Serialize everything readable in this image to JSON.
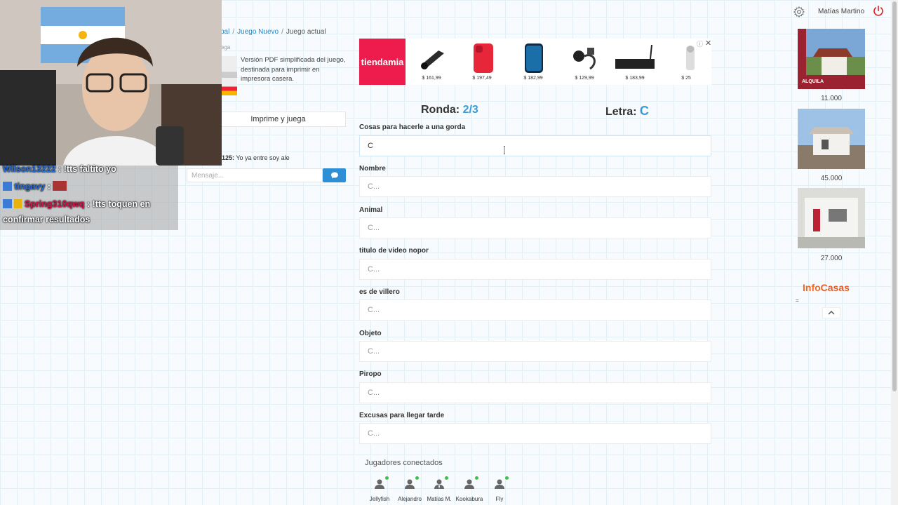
{
  "header": {
    "user_name": "Matías Martino",
    "icons": [
      "gear-icon",
      "power-icon"
    ],
    "power_color": "#e02020"
  },
  "breadcrumb": {
    "items": [
      "pal",
      "Juego Nuevo",
      "Juego actual"
    ]
  },
  "promo": {
    "small_label": "ega",
    "description": "Versión PDF simplificada del juego, destinada para imprimir en impresora casera.",
    "button_label": "Imprime y juega"
  },
  "chat": {
    "message_user": "125:",
    "message_text": "Yo ya entre soy ale",
    "input_placeholder": "Mensaje...",
    "send_icon": "comment-icon"
  },
  "stream_chat": {
    "rows": [
      {
        "user": "Wilson13222",
        "text": ": !tts faltito yo"
      },
      {
        "user": "tingavy",
        "text": ":"
      },
      {
        "user": "Spring310qwq",
        "text": ": !tts toquen en"
      },
      {
        "user": "",
        "text": "confirmar resultados"
      }
    ]
  },
  "ad_banner": {
    "brand": "tiendamia",
    "items": [
      {
        "price": "$ 161,99",
        "color": "#2b2b2b"
      },
      {
        "price": "$ 197,49",
        "color": "#e8263a"
      },
      {
        "price": "$ 182,99",
        "color": "#1b6fa8"
      },
      {
        "price": "$ 129,99",
        "color": "#333333"
      },
      {
        "price": "$ 183,99",
        "color": "#222222"
      },
      {
        "price": "$ 25",
        "color": "#dddddd"
      }
    ],
    "close": "✕"
  },
  "game": {
    "round_label": "Ronda:",
    "round_value": "2/3",
    "letter_label": "Letra:",
    "letter_value": "C",
    "accent": "#3a9ad9",
    "categories": [
      {
        "label": "Cosas para hacerle a una gorda",
        "value": "C",
        "placeholder": "C..."
      },
      {
        "label": "Nombre",
        "value": "",
        "placeholder": "C..."
      },
      {
        "label": "Animal",
        "value": "",
        "placeholder": "C..."
      },
      {
        "label": "titulo de video nopor",
        "value": "",
        "placeholder": "C..."
      },
      {
        "label": "es de villero",
        "value": "",
        "placeholder": "C..."
      },
      {
        "label": "Objeto",
        "value": "",
        "placeholder": "C..."
      },
      {
        "label": "Piropo",
        "value": "",
        "placeholder": "C..."
      },
      {
        "label": "Excusas para llegar tarde",
        "value": "",
        "placeholder": "C..."
      }
    ]
  },
  "players": {
    "title": "Jugadores conectados",
    "list": [
      "Jellyfish",
      "Alejandro",
      "Matías M.",
      "Kookabura",
      "Fly"
    ],
    "online_color": "#3cc24c"
  },
  "real_estate": {
    "prices": [
      "11.000",
      "45.000",
      "27.000"
    ],
    "badge": "ALQUILA",
    "logo_a": "Info",
    "logo_b": "Casas",
    "eq": "=",
    "up_icon": "chevron-up-icon"
  }
}
